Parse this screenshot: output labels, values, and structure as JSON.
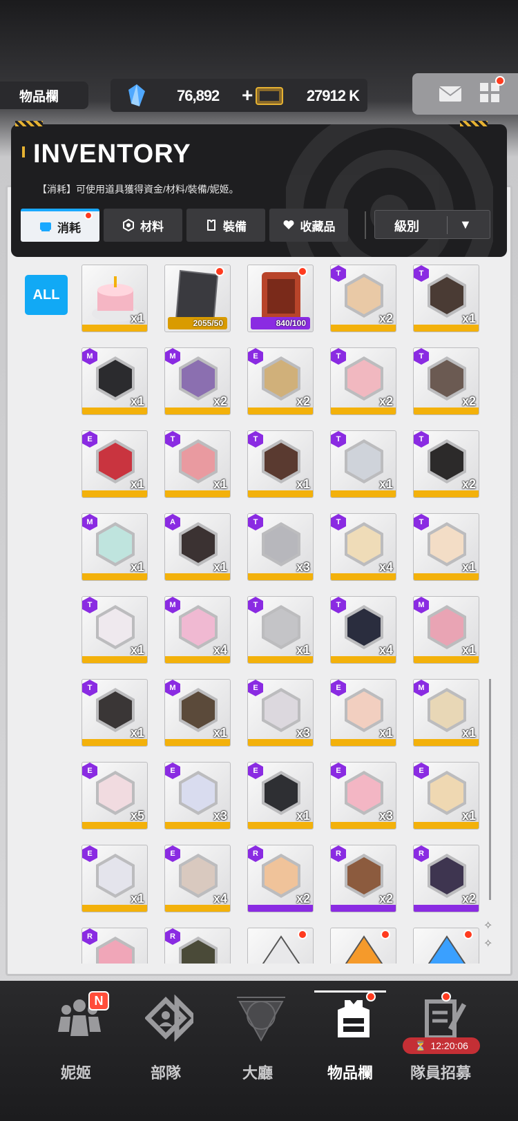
{
  "top": {
    "page_label": "物品欄",
    "gem_value": "76,892",
    "gem_plus": "+",
    "credit_value": "27912 K"
  },
  "inventory": {
    "title": "INVENTORY",
    "subtitle": "【消耗】可使用道具獲得資金/材料/裝備/妮姬。",
    "tabs": [
      {
        "label": "消耗",
        "icon": "card-icon",
        "active": true,
        "notify": true
      },
      {
        "label": "材料",
        "icon": "gear-icon",
        "active": false
      },
      {
        "label": "裝備",
        "icon": "armor-icon",
        "active": false
      },
      {
        "label": "收藏品",
        "icon": "heart-icon",
        "active": false
      }
    ],
    "sort_label": "級別",
    "sort_arrow": "▼",
    "filter_all": "ALL"
  },
  "items": [
    {
      "type": "cake",
      "qty": "x1",
      "stripe": "gold"
    },
    {
      "type": "card",
      "bar": "2055/50",
      "bar_color": "#d99b00",
      "dot": true
    },
    {
      "type": "box",
      "bar": "840/100",
      "bar_color": "#8a2be2",
      "dot": true
    },
    {
      "badge": "T",
      "qty": "x2",
      "color": "#e9c9a6",
      "stripe": "gold"
    },
    {
      "badge": "T",
      "qty": "x1",
      "color": "#4a3b34",
      "stripe": "gold"
    },
    {
      "badge": "M",
      "qty": "x1",
      "color": "#2b2b2e",
      "stripe": "gold"
    },
    {
      "badge": "M",
      "qty": "x2",
      "color": "#8b6fb0",
      "stripe": "gold"
    },
    {
      "badge": "E",
      "qty": "x2",
      "color": "#d0b07a",
      "stripe": "gold"
    },
    {
      "badge": "T",
      "qty": "x2",
      "color": "#f1b8c0",
      "stripe": "gold"
    },
    {
      "badge": "T",
      "qty": "x2",
      "color": "#6b5a52",
      "stripe": "gold"
    },
    {
      "badge": "E",
      "qty": "x1",
      "color": "#c9343f",
      "stripe": "gold"
    },
    {
      "badge": "T",
      "qty": "x1",
      "color": "#e99aa0",
      "stripe": "gold"
    },
    {
      "badge": "T",
      "qty": "x1",
      "color": "#5a3a30",
      "stripe": "gold"
    },
    {
      "badge": "T",
      "qty": "x1",
      "color": "#cfd3da",
      "stripe": "gold"
    },
    {
      "badge": "T",
      "qty": "x2",
      "color": "#2c2a2a",
      "stripe": "gold"
    },
    {
      "badge": "M",
      "qty": "x1",
      "color": "#bfe4de",
      "stripe": "gold"
    },
    {
      "badge": "A",
      "qty": "x1",
      "color": "#3b3232",
      "stripe": "gold"
    },
    {
      "badge": "T",
      "qty": "x3",
      "color": "#b7b7bc",
      "stripe": "gold"
    },
    {
      "badge": "T",
      "qty": "x4",
      "color": "#efdcb8",
      "stripe": "gold"
    },
    {
      "badge": "T",
      "qty": "x1",
      "color": "#f3ddc6",
      "stripe": "gold"
    },
    {
      "badge": "T",
      "qty": "x1",
      "color": "#efe9ee",
      "stripe": "gold"
    },
    {
      "badge": "M",
      "qty": "x4",
      "color": "#f0b9d2",
      "stripe": "gold"
    },
    {
      "badge": "T",
      "qty": "x1",
      "color": "#c4c4c7",
      "stripe": "gold"
    },
    {
      "badge": "T",
      "qty": "x4",
      "color": "#2a2d3e",
      "stripe": "gold"
    },
    {
      "badge": "M",
      "qty": "x1",
      "color": "#e9a4b4",
      "stripe": "gold"
    },
    {
      "badge": "T",
      "qty": "x1",
      "color": "#3a3636",
      "stripe": "gold"
    },
    {
      "badge": "M",
      "qty": "x1",
      "color": "#5b4a3a",
      "stripe": "gold"
    },
    {
      "badge": "E",
      "qty": "x3",
      "color": "#dcd8de",
      "stripe": "gold"
    },
    {
      "badge": "E",
      "qty": "x1",
      "color": "#f2cfc0",
      "stripe": "gold"
    },
    {
      "badge": "M",
      "qty": "x1",
      "color": "#e8d7b6",
      "stripe": "gold"
    },
    {
      "badge": "E",
      "qty": "x5",
      "color": "#f1dbe0",
      "stripe": "gold"
    },
    {
      "badge": "E",
      "qty": "x3",
      "color": "#d9dcef",
      "stripe": "gold"
    },
    {
      "badge": "E",
      "qty": "x1",
      "color": "#2e2f33",
      "stripe": "gold"
    },
    {
      "badge": "E",
      "qty": "x3",
      "color": "#f3b6c4",
      "stripe": "gold"
    },
    {
      "badge": "E",
      "qty": "x1",
      "color": "#efd8b2",
      "stripe": "gold"
    },
    {
      "badge": "E",
      "qty": "x1",
      "color": "#e4e4ec",
      "stripe": "gold"
    },
    {
      "badge": "E",
      "qty": "x4",
      "color": "#d9c9bf",
      "stripe": "gold"
    },
    {
      "badge": "R",
      "qty": "x2",
      "color": "#f0c39a",
      "stripe": "purple"
    },
    {
      "badge": "R",
      "qty": "x2",
      "color": "#8c5b3e",
      "stripe": "purple"
    },
    {
      "badge": "R",
      "qty": "x2",
      "color": "#3e3550",
      "stripe": "purple"
    },
    {
      "badge": "R",
      "qty": "",
      "color": "#f0a6b8",
      "stripe": "purple"
    },
    {
      "badge": "R",
      "qty": "",
      "color": "#4a4a38",
      "stripe": "purple"
    },
    {
      "type": "crystal",
      "qty": "",
      "color": "#e8e8ea",
      "dot": true
    },
    {
      "type": "crystal",
      "qty": "",
      "color": "#f59a2b",
      "dot": true
    },
    {
      "type": "crystal",
      "qty": "",
      "color": "#3aa0ff",
      "dot": true
    }
  ],
  "nav": [
    {
      "label": "妮姬",
      "icon": "people-icon"
    },
    {
      "label": "部隊",
      "icon": "squad-icon"
    },
    {
      "label": "大廳",
      "icon": "lobby-icon"
    },
    {
      "label": "物品欄",
      "icon": "inventory-icon",
      "active": true
    },
    {
      "label": "隊員招募",
      "icon": "recruit-icon"
    }
  ],
  "nav_badge_new": "N",
  "recruit_timer": "12:20:06",
  "colors": {
    "accent_blue": "#11a9f5",
    "gold": "#f3b10b",
    "purple": "#8a2be2",
    "notify": "#ff3b1f"
  }
}
